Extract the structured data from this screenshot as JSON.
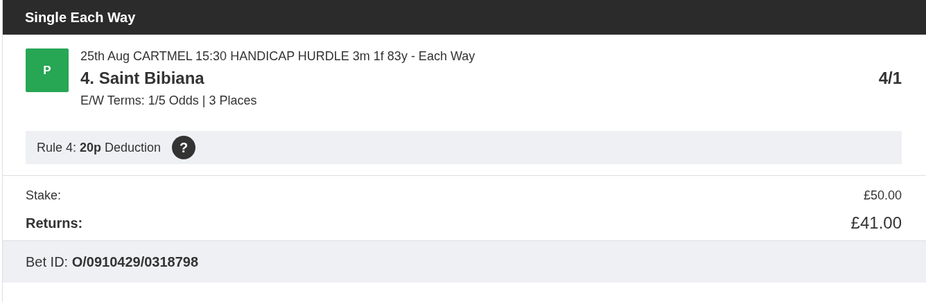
{
  "header": {
    "title": "Single Each Way"
  },
  "selection": {
    "badge": "P",
    "race": "25th Aug CARTMEL 15:30 HANDICAP HURDLE 3m 1f 83y - Each Way",
    "runner": "4. Saint Bibiana",
    "odds": "4/1",
    "terms": "E/W Terms: 1/5 Odds | 3 Places"
  },
  "rule4": {
    "text": "Rule 4: **20p** Deduction",
    "help": "?"
  },
  "stake": {
    "label": "Stake:",
    "value": "£50.00"
  },
  "returns": {
    "label": "Returns:",
    "value": "£41.00"
  },
  "footer": {
    "bet_id": "Bet ID: **O/0910429/0318798**"
  }
}
